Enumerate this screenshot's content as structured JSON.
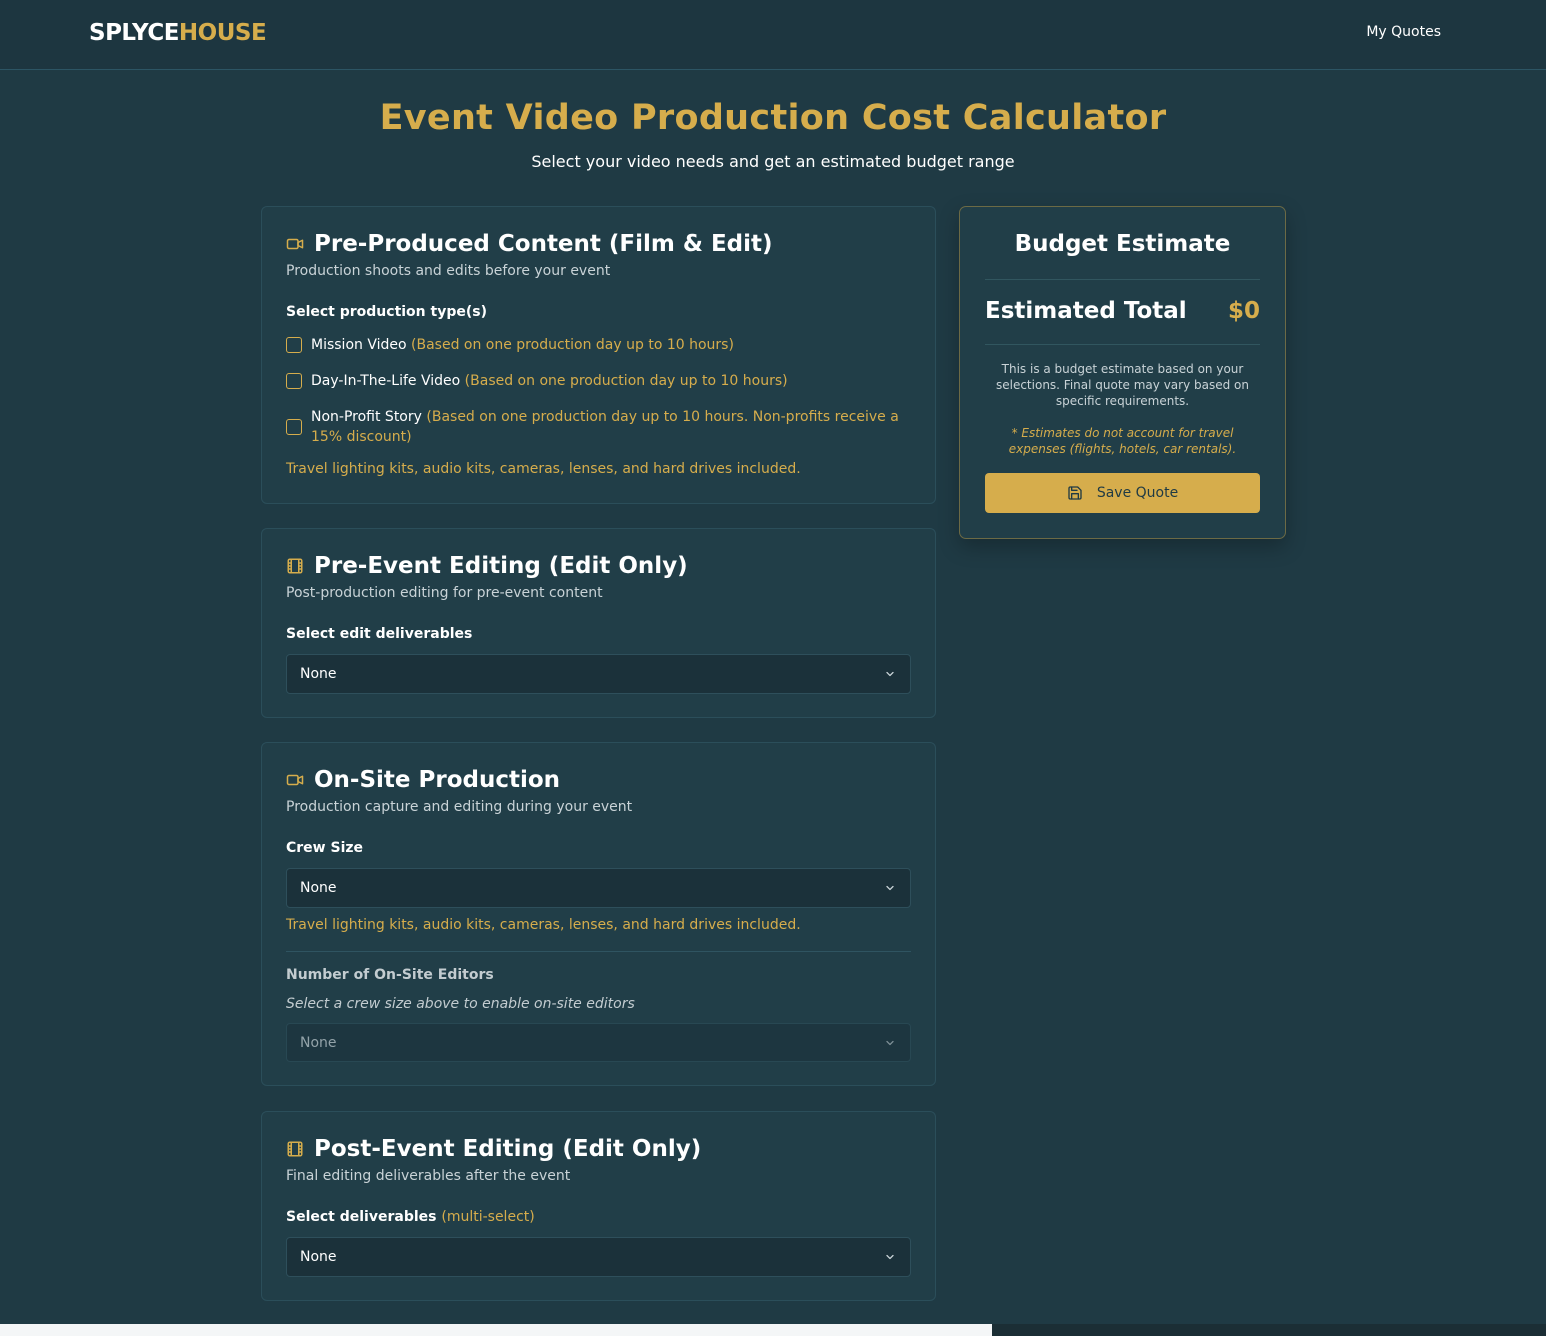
{
  "header": {
    "logo_part1": "SPLYCE",
    "logo_part2": "HOUSE",
    "nav_my_quotes": "My Quotes"
  },
  "hero": {
    "title": "Event Video Production Cost Calculator",
    "subtitle": "Select your video needs and get an estimated budget range"
  },
  "sections": {
    "pre_produced": {
      "icon": "video-camera-icon",
      "title": "Pre-Produced Content (Film & Edit)",
      "description": "Production shoots and edits before your event",
      "field_label": "Select production type(s)",
      "options": [
        {
          "label": "Mission Video",
          "note": "(Based on one production day up to 10 hours)",
          "checked": false
        },
        {
          "label": "Day-In-The-Life Video",
          "note": "(Based on one production day up to 10 hours)",
          "checked": false
        },
        {
          "label": "Non-Profit Story",
          "note": "(Based on one production day up to 10 hours. Non-profits receive a 15% discount)",
          "checked": false
        }
      ],
      "included_note": "Travel lighting kits, audio kits, cameras, lenses, and hard drives included."
    },
    "pre_event_editing": {
      "icon": "film-icon",
      "title": "Pre-Event Editing (Edit Only)",
      "description": "Post-production editing for pre-event content",
      "field_label": "Select edit deliverables",
      "select_value": "None"
    },
    "on_site": {
      "icon": "video-camera-icon",
      "title": "On-Site Production",
      "description": "Production capture and editing during your event",
      "crew_label": "Crew Size",
      "crew_value": "None",
      "included_note": "Travel lighting kits, audio kits, cameras, lenses, and hard drives included.",
      "editors_label": "Number of On-Site Editors",
      "editors_hint": "Select a crew size above to enable on-site editors",
      "editors_value": "None"
    },
    "post_event_editing": {
      "icon": "film-icon",
      "title": "Post-Event Editing (Edit Only)",
      "description": "Final editing deliverables after the event",
      "field_label": "Select deliverables",
      "field_label_note": "(multi-select)",
      "select_value": "None"
    }
  },
  "budget": {
    "title": "Budget Estimate",
    "total_label": "Estimated Total",
    "total_value": "$0",
    "note": "This is a budget estimate based on your selections. Final quote may vary based on specific requirements.",
    "disclaimer": "* Estimates do not account for travel expenses (flights, hotels, car rentals).",
    "save_label": "Save Quote",
    "save_icon": "save-icon"
  },
  "colors": {
    "background": "#1f3a44",
    "accent": "#d6ad4c",
    "card": "#213e48"
  }
}
